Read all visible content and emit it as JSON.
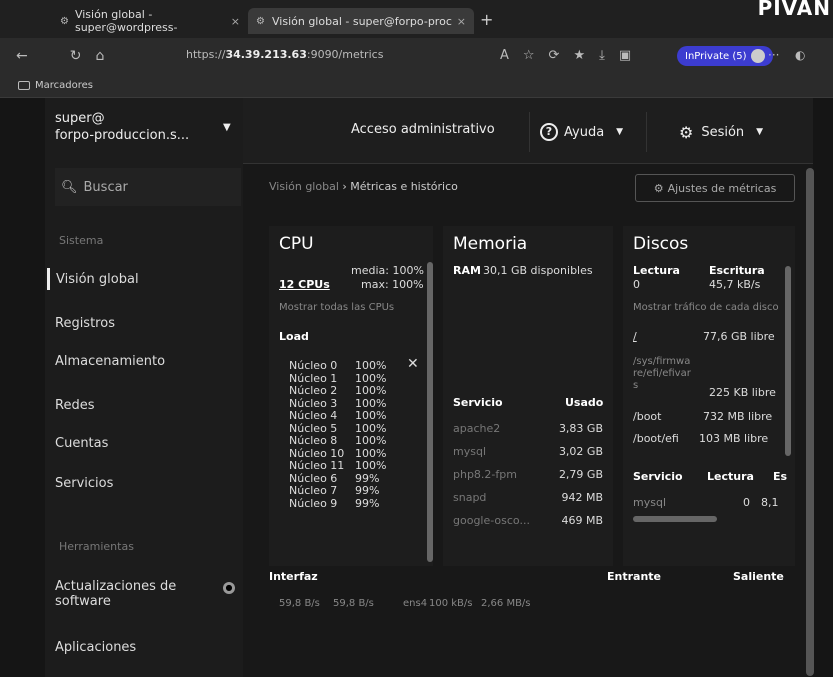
{
  "browser": {
    "tabs": [
      {
        "title": "Visión global - super@wordpress-"
      },
      {
        "title": "Visión global - super@forpo-proc"
      }
    ],
    "url_prefix": "https://",
    "url_host": "34.39.213.63",
    "url_rest": ":9090/metrics",
    "inprivate_label": "InPrivate (5)",
    "bookmarks_label": "Marcadores",
    "corner_text": "PIVAN"
  },
  "sidebar": {
    "host_line1": "super@",
    "host_line2": "forpo-produccion.s...",
    "search_placeholder": "Buscar",
    "group_system": "Sistema",
    "items": [
      {
        "label": "Visión global"
      },
      {
        "label": "Registros"
      },
      {
        "label": "Almacenamiento"
      },
      {
        "label": "Redes"
      },
      {
        "label": "Cuentas"
      },
      {
        "label": "Servicios"
      }
    ],
    "group_tools": "Herramientas",
    "updates_line1": "Actualizaciones de",
    "updates_line2": "software",
    "apps": "Aplicaciones"
  },
  "topbar": {
    "admin": "Acceso administrativo",
    "help": "Ayuda",
    "session": "Sesión"
  },
  "breadcrumb": {
    "root": "Visión global",
    "sep": "›",
    "current": "Métricas e histórico"
  },
  "metrics_settings": "Ajustes de métricas",
  "cpu": {
    "title": "CPU",
    "media": "media: 100%",
    "cpus": "12 CPUs",
    "max": "max: 100%",
    "show_all": "Mostrar todas las CPUs",
    "load": "Load",
    "cores": [
      {
        "name": "Núcleo 0",
        "val": "100%"
      },
      {
        "name": "Núcleo 1",
        "val": "100%"
      },
      {
        "name": "Núcleo 2",
        "val": "100%"
      },
      {
        "name": "Núcleo 3",
        "val": "100%"
      },
      {
        "name": "Núcleo 4",
        "val": "100%"
      },
      {
        "name": "Núcleo 5",
        "val": "100%"
      },
      {
        "name": "Núcleo 8",
        "val": "100%"
      },
      {
        "name": "Núcleo 10",
        "val": "100%"
      },
      {
        "name": "Núcleo 11",
        "val": "100%"
      },
      {
        "name": "Núcleo 6",
        "val": "99%"
      },
      {
        "name": "Núcleo 7",
        "val": "99%"
      },
      {
        "name": "Núcleo 9",
        "val": "99%"
      }
    ]
  },
  "memory": {
    "title": "Memoria",
    "ram_label": "RAM",
    "ram_value": "30,1 GB disponibles",
    "col_service": "Servicio",
    "col_used": "Usado",
    "rows": [
      {
        "svc": "apache2",
        "used": "3,83 GB"
      },
      {
        "svc": "mysql",
        "used": "3,02 GB"
      },
      {
        "svc": "php8.2-fpm",
        "used": "2,79 GB"
      },
      {
        "svc": "snapd",
        "used": "942 MB"
      },
      {
        "svc": "google-osco...",
        "used": "469 MB"
      }
    ]
  },
  "disks": {
    "title": "Discos",
    "read": "Lectura",
    "write": "Escritura",
    "read_val": "0",
    "write_val": "45,7 kB/s",
    "show_traffic": "Mostrar tráfico de cada disco",
    "mounts": [
      {
        "path": "/",
        "free": "77,6 GB libre"
      },
      {
        "path": "/sys/firmware/efi/efivars",
        "free": "225 KB libre"
      },
      {
        "path": "/boot",
        "free": "732 MB libre"
      },
      {
        "path": "/boot/efi",
        "free": "103 MB libre"
      }
    ],
    "col_service": "Servicio",
    "col_read": "Lectura",
    "col_write": "Es",
    "svc_row": {
      "svc": "mysql",
      "read": "0",
      "write": "8,1"
    }
  },
  "interfaces": {
    "label": "Interfaz",
    "in": "Entrante",
    "out": "Saliente",
    "row": {
      "a": "59,8 B/s",
      "b": "59,8 B/s",
      "name": "ens4",
      "c": "100 kB/s",
      "d": "2,66 MB/s"
    }
  }
}
